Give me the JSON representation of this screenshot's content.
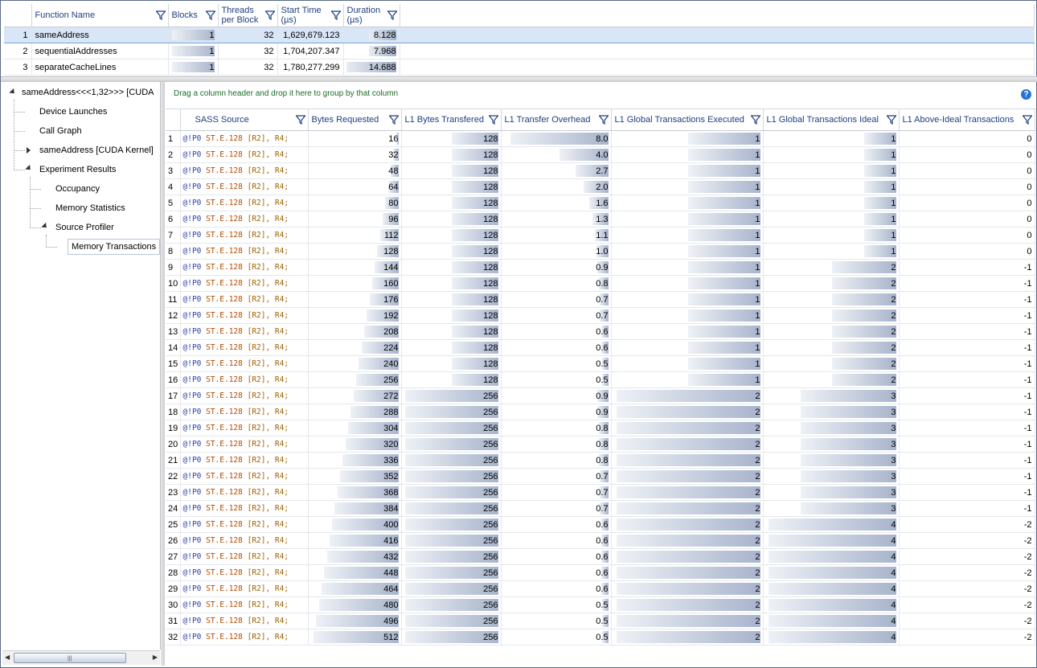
{
  "functions": {
    "headers": [
      "Function Name",
      "Blocks",
      "Threads per Block",
      "Start Time (µs)",
      "Duration (µs)"
    ],
    "header_lines": [
      [
        "Function Name"
      ],
      [
        "Blocks"
      ],
      [
        "Threads",
        "per Block"
      ],
      [
        "Start Time",
        "(µs)"
      ],
      [
        "Duration",
        "(µs)"
      ]
    ],
    "rows": [
      {
        "idx": "1",
        "name": "sameAddress",
        "blocks": "1",
        "threads": "32",
        "start": "1,629,679.123",
        "duration": "8.128",
        "duration_value": 8.128,
        "selected": true
      },
      {
        "idx": "2",
        "name": "sequentialAddresses",
        "blocks": "1",
        "threads": "32",
        "start": "1,704,207.347",
        "duration": "7.968",
        "duration_value": 7.968,
        "selected": false
      },
      {
        "idx": "3",
        "name": "separateCacheLines",
        "blocks": "1",
        "threads": "32",
        "start": "1,780,277.299",
        "duration": "14.688",
        "duration_value": 14.688,
        "selected": false
      }
    ]
  },
  "tree": {
    "root": "sameAddress<<<1,32>>> [CUDA",
    "items": [
      {
        "label": "Device Launches",
        "level": 1,
        "expander": "none"
      },
      {
        "label": "Call Graph",
        "level": 1,
        "expander": "none"
      },
      {
        "label": "sameAddress [CUDA Kernel]",
        "level": 1,
        "expander": "collapsed"
      },
      {
        "label": "Experiment Results",
        "level": 1,
        "expander": "expanded"
      },
      {
        "label": "Occupancy",
        "level": 2,
        "expander": "none"
      },
      {
        "label": "Memory Statistics",
        "level": 2,
        "expander": "none"
      },
      {
        "label": "Source Profiler",
        "level": 2,
        "expander": "expanded"
      },
      {
        "label": "Memory Transactions",
        "level": 3,
        "expander": "none",
        "selected": true
      }
    ]
  },
  "grouping_hint": "Drag a column header and drop it here to group by that column",
  "help_label": "?",
  "source_table": {
    "headers": [
      "SASS Source",
      "Bytes Requested",
      "L1 Bytes Transfered",
      "L1 Transfer Overhead",
      "L1 Global Transactions Executed",
      "L1 Global Transactions Ideal",
      "L1 Above-Ideal Transactions"
    ],
    "sass": {
      "pred": "@!P0",
      "op": "ST.E.128",
      "args": "[R2], R4;"
    },
    "rows": [
      {
        "i": "1",
        "bytes": "16",
        "l1b": "128",
        "ovh": "8.0",
        "exe": "1",
        "ideal": "1",
        "above": "0"
      },
      {
        "i": "2",
        "bytes": "32",
        "l1b": "128",
        "ovh": "4.0",
        "exe": "1",
        "ideal": "1",
        "above": "0"
      },
      {
        "i": "3",
        "bytes": "48",
        "l1b": "128",
        "ovh": "2.7",
        "exe": "1",
        "ideal": "1",
        "above": "0"
      },
      {
        "i": "4",
        "bytes": "64",
        "l1b": "128",
        "ovh": "2.0",
        "exe": "1",
        "ideal": "1",
        "above": "0"
      },
      {
        "i": "5",
        "bytes": "80",
        "l1b": "128",
        "ovh": "1.6",
        "exe": "1",
        "ideal": "1",
        "above": "0"
      },
      {
        "i": "6",
        "bytes": "96",
        "l1b": "128",
        "ovh": "1.3",
        "exe": "1",
        "ideal": "1",
        "above": "0"
      },
      {
        "i": "7",
        "bytes": "112",
        "l1b": "128",
        "ovh": "1.1",
        "exe": "1",
        "ideal": "1",
        "above": "0"
      },
      {
        "i": "8",
        "bytes": "128",
        "l1b": "128",
        "ovh": "1.0",
        "exe": "1",
        "ideal": "1",
        "above": "0"
      },
      {
        "i": "9",
        "bytes": "144",
        "l1b": "128",
        "ovh": "0.9",
        "exe": "1",
        "ideal": "2",
        "above": "-1"
      },
      {
        "i": "10",
        "bytes": "160",
        "l1b": "128",
        "ovh": "0.8",
        "exe": "1",
        "ideal": "2",
        "above": "-1"
      },
      {
        "i": "11",
        "bytes": "176",
        "l1b": "128",
        "ovh": "0.7",
        "exe": "1",
        "ideal": "2",
        "above": "-1"
      },
      {
        "i": "12",
        "bytes": "192",
        "l1b": "128",
        "ovh": "0.7",
        "exe": "1",
        "ideal": "2",
        "above": "-1"
      },
      {
        "i": "13",
        "bytes": "208",
        "l1b": "128",
        "ovh": "0.6",
        "exe": "1",
        "ideal": "2",
        "above": "-1"
      },
      {
        "i": "14",
        "bytes": "224",
        "l1b": "128",
        "ovh": "0.6",
        "exe": "1",
        "ideal": "2",
        "above": "-1"
      },
      {
        "i": "15",
        "bytes": "240",
        "l1b": "128",
        "ovh": "0.5",
        "exe": "1",
        "ideal": "2",
        "above": "-1"
      },
      {
        "i": "16",
        "bytes": "256",
        "l1b": "128",
        "ovh": "0.5",
        "exe": "1",
        "ideal": "2",
        "above": "-1"
      },
      {
        "i": "17",
        "bytes": "272",
        "l1b": "256",
        "ovh": "0.9",
        "exe": "2",
        "ideal": "3",
        "above": "-1"
      },
      {
        "i": "18",
        "bytes": "288",
        "l1b": "256",
        "ovh": "0.9",
        "exe": "2",
        "ideal": "3",
        "above": "-1"
      },
      {
        "i": "19",
        "bytes": "304",
        "l1b": "256",
        "ovh": "0.8",
        "exe": "2",
        "ideal": "3",
        "above": "-1"
      },
      {
        "i": "20",
        "bytes": "320",
        "l1b": "256",
        "ovh": "0.8",
        "exe": "2",
        "ideal": "3",
        "above": "-1"
      },
      {
        "i": "21",
        "bytes": "336",
        "l1b": "256",
        "ovh": "0.8",
        "exe": "2",
        "ideal": "3",
        "above": "-1"
      },
      {
        "i": "22",
        "bytes": "352",
        "l1b": "256",
        "ovh": "0.7",
        "exe": "2",
        "ideal": "3",
        "above": "-1"
      },
      {
        "i": "23",
        "bytes": "368",
        "l1b": "256",
        "ovh": "0.7",
        "exe": "2",
        "ideal": "3",
        "above": "-1"
      },
      {
        "i": "24",
        "bytes": "384",
        "l1b": "256",
        "ovh": "0.7",
        "exe": "2",
        "ideal": "3",
        "above": "-1"
      },
      {
        "i": "25",
        "bytes": "400",
        "l1b": "256",
        "ovh": "0.6",
        "exe": "2",
        "ideal": "4",
        "above": "-2"
      },
      {
        "i": "26",
        "bytes": "416",
        "l1b": "256",
        "ovh": "0.6",
        "exe": "2",
        "ideal": "4",
        "above": "-2"
      },
      {
        "i": "27",
        "bytes": "432",
        "l1b": "256",
        "ovh": "0.6",
        "exe": "2",
        "ideal": "4",
        "above": "-2"
      },
      {
        "i": "28",
        "bytes": "448",
        "l1b": "256",
        "ovh": "0.6",
        "exe": "2",
        "ideal": "4",
        "above": "-2"
      },
      {
        "i": "29",
        "bytes": "464",
        "l1b": "256",
        "ovh": "0.6",
        "exe": "2",
        "ideal": "4",
        "above": "-2"
      },
      {
        "i": "30",
        "bytes": "480",
        "l1b": "256",
        "ovh": "0.5",
        "exe": "2",
        "ideal": "4",
        "above": "-2"
      },
      {
        "i": "31",
        "bytes": "496",
        "l1b": "256",
        "ovh": "0.5",
        "exe": "2",
        "ideal": "4",
        "above": "-2"
      },
      {
        "i": "32",
        "bytes": "512",
        "l1b": "256",
        "ovh": "0.5",
        "exe": "2",
        "ideal": "4",
        "above": "-2"
      }
    ]
  },
  "icons": {
    "filter": "filter-funnel-icon",
    "help": "help-icon"
  },
  "colors": {
    "header_text": "#1f3f80",
    "grouping_text": "#1d6b2c",
    "selection": "#d8e6f7",
    "bar_dark": "#a8b4cc"
  }
}
